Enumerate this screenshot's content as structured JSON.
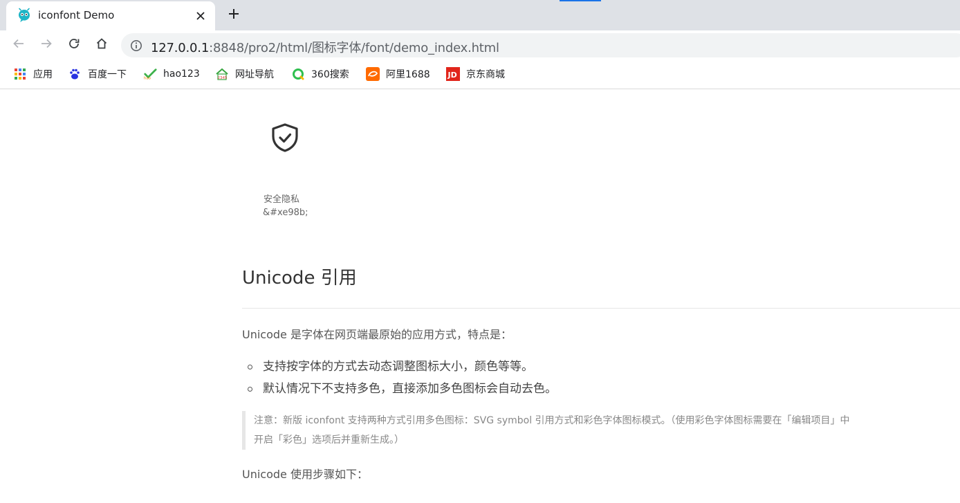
{
  "browser": {
    "tab": {
      "title": "iconfont Demo",
      "favicon": "iconfont-logo-icon",
      "close_icon": "close-icon"
    },
    "new_tab_icon": "plus-icon",
    "nav": {
      "back_icon": "arrow-left-icon",
      "forward_icon": "arrow-right-icon",
      "reload_icon": "reload-icon",
      "home_icon": "home-icon"
    },
    "address": {
      "info_icon": "info-icon",
      "host": "127.0.0.1",
      "rest": ":8848/pro2/html/图标字体/font/demo_index.html"
    },
    "bookmarks": [
      {
        "label": "应用",
        "icon": "apps-grid-icon"
      },
      {
        "label": "百度一下",
        "icon": "baidu-paw-icon"
      },
      {
        "label": "hao123",
        "icon": "hao123-icon"
      },
      {
        "label": "网址导航",
        "icon": "2345-house-icon"
      },
      {
        "label": "360搜索",
        "icon": "360-search-icon"
      },
      {
        "label": "阿里1688",
        "icon": "alibaba-1688-icon"
      },
      {
        "label": "京东商城",
        "icon": "jd-icon"
      }
    ]
  },
  "content": {
    "icon_card": {
      "glyph": "shield-check-icon",
      "name": "安全隐私",
      "code": "&#xe98b;"
    },
    "section_title": "Unicode 引用",
    "intro": "Unicode 是字体在网页端最原始的应用方式，特点是：",
    "features": [
      "支持按字体的方式去动态调整图标大小，颜色等等。",
      "默认情况下不支持多色，直接添加多色图标会自动去色。"
    ],
    "note_lines": [
      "注意：新版 iconfont 支持两种方式引用多色图标：SVG symbol 引用方式和彩色字体图标模式。（使用彩色字体图标需要在「编辑项目」中",
      "开启「彩色」选项后并重新生成。）"
    ],
    "steps_heading": "Unicode 使用步骤如下："
  },
  "colors": {
    "tabstrip_bg": "#dee1e6",
    "omnibox_bg": "#f1f3f4",
    "accent": "#1a73e8",
    "favicon": "#1fb5c6"
  }
}
